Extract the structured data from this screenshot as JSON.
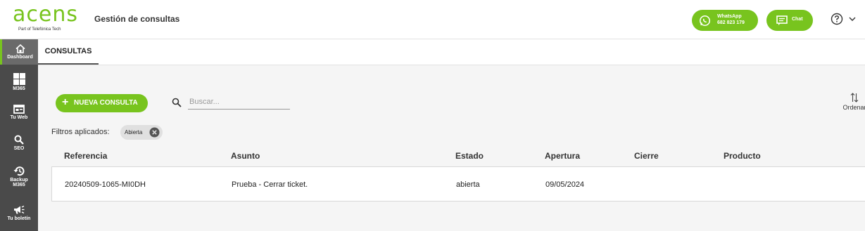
{
  "brand": {
    "name": "acens",
    "tagline": "Part of Telefónica Tech",
    "accent": "#78c41e"
  },
  "header": {
    "title": "Gestión de consultas",
    "whatsapp": {
      "label": "WhatsApp",
      "number": "682 823 179",
      "icon": "whatsapp-icon"
    },
    "chat": {
      "label": "Chat",
      "icon": "chat-icon"
    },
    "help_icon": "help-icon"
  },
  "sidebar": {
    "bg": "#4a4a4a",
    "items": [
      {
        "label": "Dashboard",
        "icon": "home-icon",
        "active": true
      },
      {
        "label": "M365",
        "icon": "windows-icon"
      },
      {
        "label": "Tu Web",
        "icon": "web-icon"
      },
      {
        "label": "SEO",
        "icon": "search-icon"
      },
      {
        "label": "Backup",
        "label2": "M365",
        "icon": "backup-icon"
      },
      {
        "label": "Tu boletín",
        "icon": "megaphone-icon"
      }
    ]
  },
  "tabs": [
    {
      "label": "CONSULTAS",
      "active": true
    }
  ],
  "toolbar": {
    "new_label": "NUEVA CONSULTA",
    "search_placeholder": "Buscar...",
    "sort_label": "Ordenar"
  },
  "filters": {
    "label": "Filtros aplicados:",
    "chips": [
      {
        "label": "Abierta"
      }
    ]
  },
  "table": {
    "columns": [
      "Referencia",
      "Asunto",
      "Estado",
      "Apertura",
      "Cierre",
      "Producto"
    ],
    "rows": [
      {
        "referencia": "20240509-1065-MI0DH",
        "asunto": "Prueba - Cerrar ticket.",
        "estado": "abierta",
        "apertura": "09/05/2024",
        "cierre": "",
        "producto": ""
      }
    ]
  }
}
